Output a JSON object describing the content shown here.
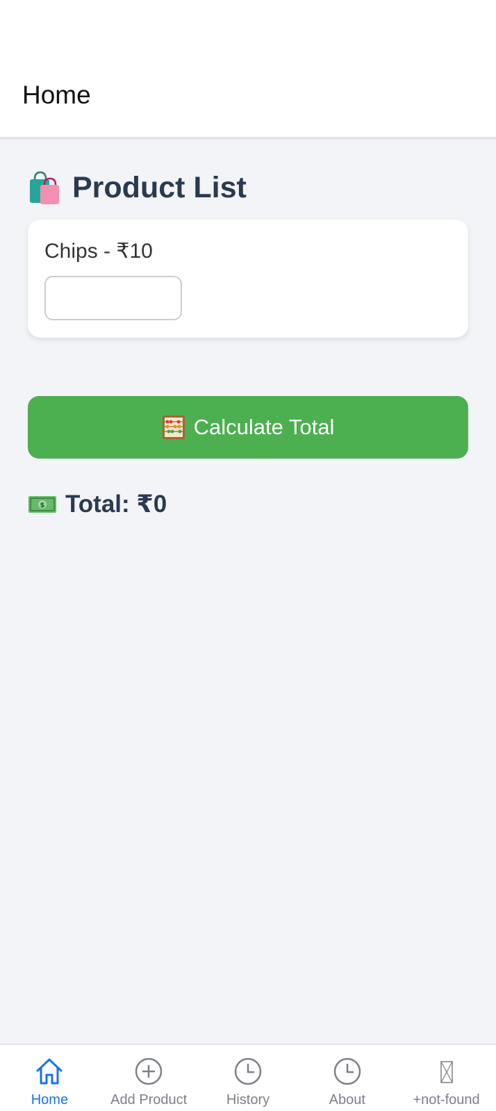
{
  "header": {
    "title": "Home"
  },
  "main": {
    "section_title": "Product List",
    "products": [
      {
        "label": "Chips - ₹10",
        "quantity_value": "",
        "quantity_placeholder": ""
      }
    ],
    "calculate_label": "Calculate Total",
    "total_text": "Total: ₹0"
  },
  "icons": {
    "section": "shopping-bags-icon",
    "calculate": "abacus-icon",
    "total": "money-icon"
  },
  "nav": {
    "items": [
      {
        "label": "Home",
        "icon": "home-icon",
        "active": true
      },
      {
        "label": "Add Product",
        "icon": "add-circle-icon",
        "active": false
      },
      {
        "label": "History",
        "icon": "clock-icon",
        "active": false
      },
      {
        "label": "About",
        "icon": "clock-icon",
        "active": false
      },
      {
        "label": "+not-found",
        "icon": "missing-glyph-icon",
        "active": false
      }
    ]
  },
  "colors": {
    "accent": "#1a73e8",
    "button": "#4caf50",
    "heading": "#2a3a4f",
    "background": "#f2f4f8"
  }
}
